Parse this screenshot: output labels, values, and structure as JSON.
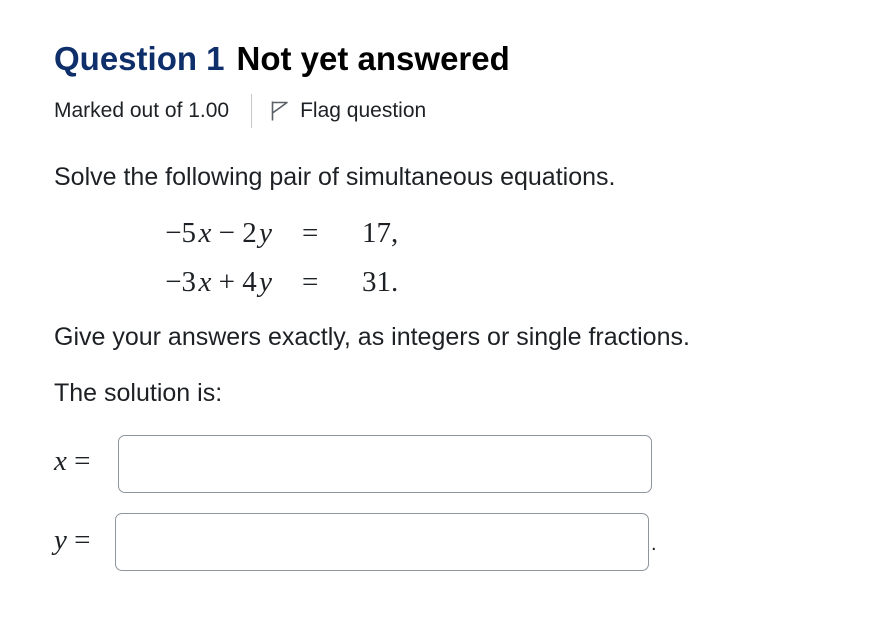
{
  "question": {
    "number_label": "Question 1",
    "state": "Not yet answered",
    "marks_label": "Marked out of 1.00",
    "flag_label": "Flag question",
    "flag_icon": "flag-outline-icon"
  },
  "content": {
    "prompt": "Solve the following pair of simultaneous equations.",
    "equations": [
      {
        "lhs_coef1": "−5",
        "lhs_var1": "x",
        "lhs_op": "−",
        "lhs_coef2": "2",
        "lhs_var2": "y",
        "eq": "=",
        "rhs": "17,"
      },
      {
        "lhs_coef1": "−3",
        "lhs_var1": "x",
        "lhs_op": "+",
        "lhs_coef2": "4",
        "lhs_var2": "y",
        "eq": "=",
        "rhs": "31."
      }
    ],
    "instruction": "Give your answers exactly, as integers or single fractions.",
    "solution_intro": "The solution is:"
  },
  "answers": {
    "x": {
      "var": "x",
      "eq": "=",
      "value": ""
    },
    "y": {
      "var": "y",
      "eq": "=",
      "value": "",
      "trailing": "."
    }
  }
}
